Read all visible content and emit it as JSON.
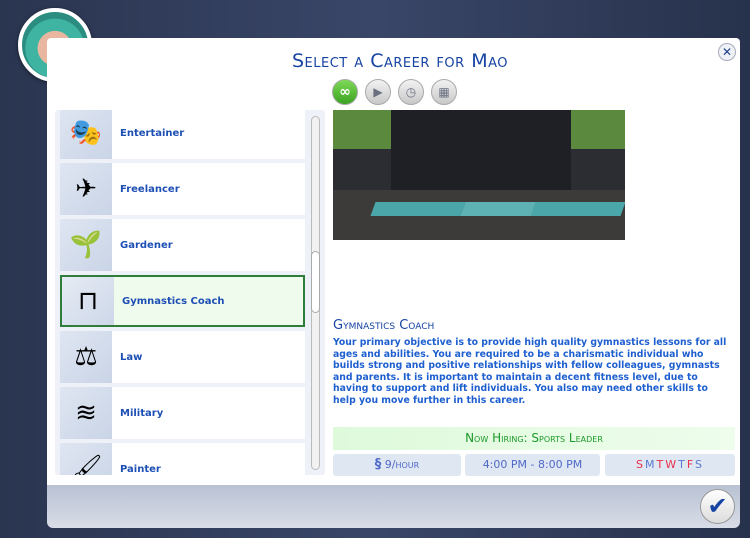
{
  "dialog": {
    "title": "Select a Career for Mao",
    "close_icon": "close-icon",
    "confirm_icon": "checkmark-icon"
  },
  "filters": [
    {
      "name": "all-careers",
      "icon": "infinity-icon",
      "active": true
    },
    {
      "name": "full-time",
      "icon": "briefcase-play-icon"
    },
    {
      "name": "part-time",
      "icon": "briefcase-clock-icon"
    },
    {
      "name": "odd-jobs",
      "icon": "briefcases-icon"
    }
  ],
  "careers": [
    {
      "label": "Entertainer",
      "icon": "stage-curtain-icon"
    },
    {
      "label": "Freelancer",
      "icon": "paper-plane-icon"
    },
    {
      "label": "Gardener",
      "icon": "seedling-hands-icon"
    },
    {
      "label": "Gymnastics Coach",
      "icon": "monkey-bars-icon",
      "selected": true
    },
    {
      "label": "Law",
      "icon": "scales-icon"
    },
    {
      "label": "Military",
      "icon": "chevron-insignia-icon"
    },
    {
      "label": "Painter",
      "icon": "paintbrush-icon"
    }
  ],
  "detail": {
    "title": "Gymnastics Coach",
    "description": "Your primary objective is to provide high quality gymnastics lessons for all ages and abilities. You are required to be a charismatic individual who builds strong and positive relationships with fellow colleagues, gymnasts and parents. It is important to maintain a decent fitness level, due to having to support and lift individuals. You also may need other skills to help you move further in this career.",
    "hiring": "Now Hiring: Sports Leader",
    "pay_symbol": "§",
    "pay": "9/hour",
    "hours": "4:00  PM - 8:00  PM",
    "days": [
      {
        "d": "S",
        "work": true
      },
      {
        "d": "M",
        "work": false
      },
      {
        "d": "T",
        "work": true
      },
      {
        "d": "W",
        "work": true
      },
      {
        "d": "T",
        "work": false
      },
      {
        "d": "F",
        "work": true
      },
      {
        "d": "S",
        "work": false
      }
    ]
  },
  "colors": {
    "accent": "#1744a3",
    "hiring": "#1d9a2a",
    "workday": "#e8304a",
    "offday": "#5a78d0"
  }
}
